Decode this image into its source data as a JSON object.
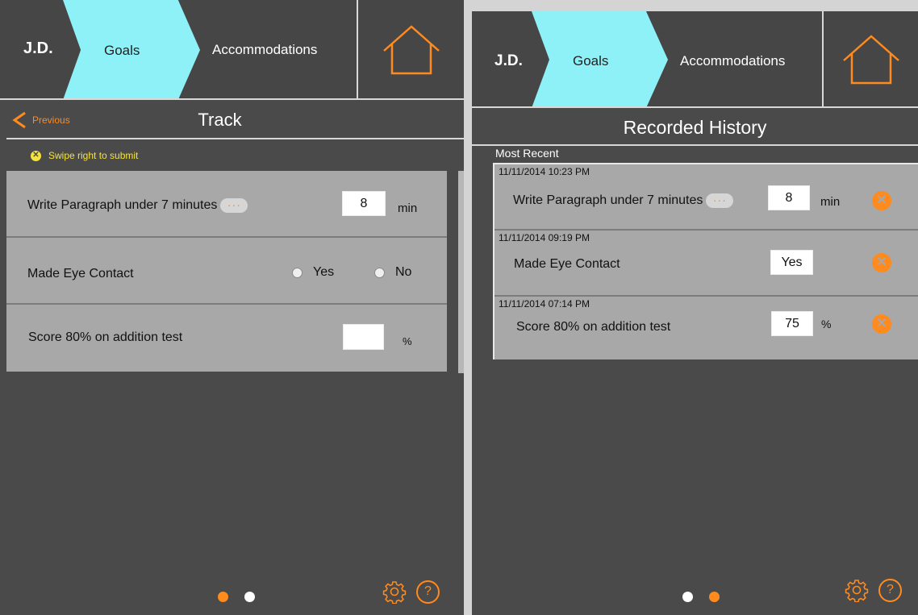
{
  "colors": {
    "accent": "#ff8a1e",
    "active_tab": "#8ef1f7",
    "panel_bg": "#4a4a4a",
    "row_bg": "#a8a8a8",
    "hint": "#f5e33a"
  },
  "track_screen": {
    "nav": {
      "student": "J.D.",
      "goals_tab": "Goals",
      "accommodations_tab": "Accommodations",
      "home_icon": "home-icon"
    },
    "previous_label": "Previous",
    "title": "Track",
    "hint": {
      "icon": "x-circle-icon",
      "text": "Swipe right to submit"
    },
    "goals": [
      {
        "label": "Write Paragraph under 7 minutes",
        "has_more": true,
        "value": "8",
        "unit": "min"
      },
      {
        "label": "Made Eye Contact",
        "options": [
          "Yes",
          "No"
        ]
      },
      {
        "label": "Score 80% on addition test",
        "value": "",
        "unit": "%"
      }
    ],
    "page_indicator": {
      "current": 1,
      "total": 2
    }
  },
  "history_screen": {
    "nav": {
      "student": "J.D.",
      "goals_tab": "Goals",
      "accommodations_tab": "Accommodations",
      "home_icon": "home-icon"
    },
    "title": "Recorded History",
    "section_label": "Most Recent",
    "entries": [
      {
        "timestamp": "11/11/2014 10:23 PM",
        "label": "Write Paragraph under 7 minutes",
        "has_more": true,
        "value": "8",
        "unit": "min"
      },
      {
        "timestamp": "11/11/2014 09:19 PM",
        "label": "Made Eye Contact",
        "value": "Yes",
        "unit": ""
      },
      {
        "timestamp": "11/11/2014 07:14 PM",
        "label": "Score 80% on addition test",
        "value": "75",
        "unit": "%"
      }
    ],
    "page_indicator": {
      "current": 2,
      "total": 2
    }
  },
  "footer_icons": {
    "settings": "gear-icon",
    "help": "?"
  }
}
